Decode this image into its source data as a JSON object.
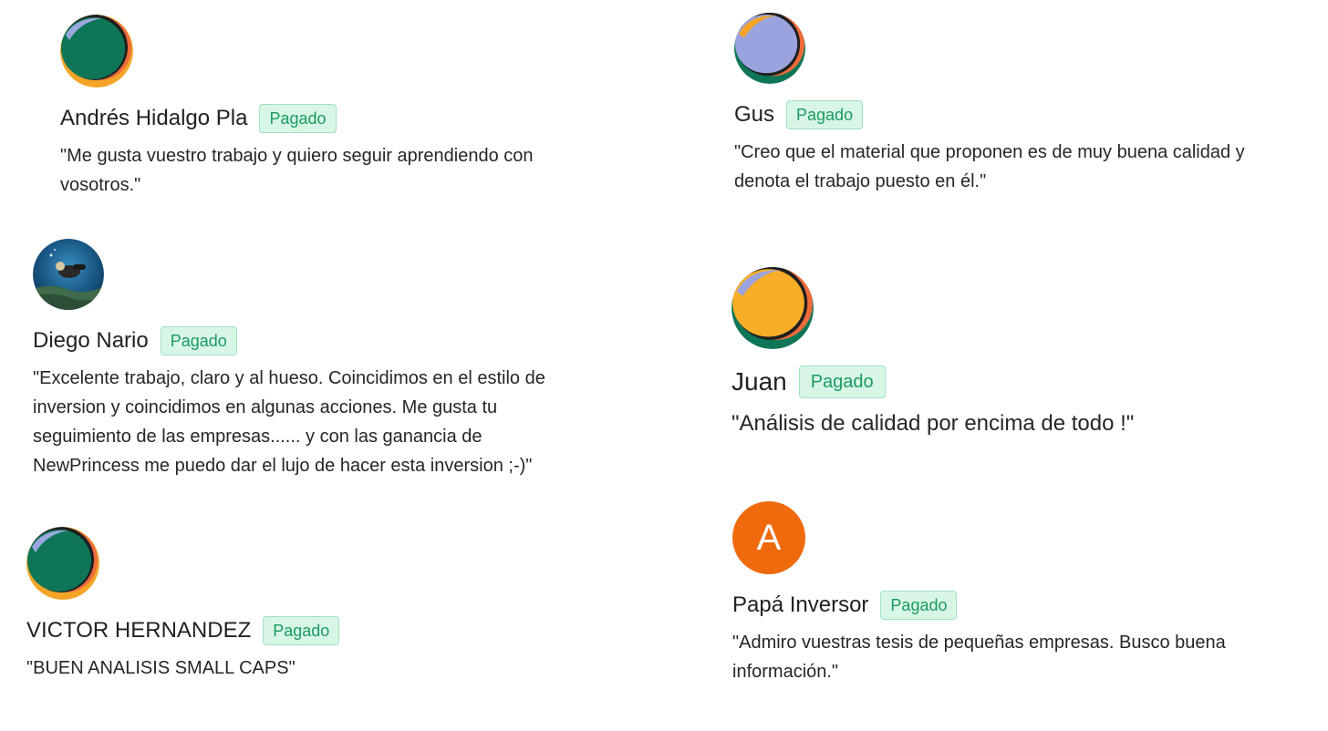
{
  "testimonials": [
    {
      "id": "andres",
      "name": "Andrés Hidalgo Pla",
      "badge": "Pagado",
      "quote": "\"Me gusta vuestro trabajo y quiero seguir aprendiendo con vosotros.\"",
      "avatar": "abstract-green-avatar"
    },
    {
      "id": "diego",
      "name": "Diego Nario",
      "badge": "Pagado",
      "quote": "\"Excelente trabajo, claro y al hueso. Coincidimos en el estilo de inversion y coincidimos en algunas acciones. Me gusta tu seguimiento de las empresas...... y con las ganancia de NewPrincess me puedo dar el lujo de hacer esta inversion ;-)\"",
      "avatar": "diver-photo-avatar"
    },
    {
      "id": "victor",
      "name": "VICTOR HERNANDEZ",
      "badge": "Pagado",
      "quote": "\"BUEN ANALISIS SMALL CAPS\"",
      "avatar": "abstract-green-avatar"
    },
    {
      "id": "gus",
      "name": "Gus",
      "badge": "Pagado",
      "quote": "\"Creo que el material que proponen es de muy buena calidad y denota el trabajo puesto en él.\"",
      "avatar": "abstract-lavender-avatar"
    },
    {
      "id": "juan",
      "name": "Juan",
      "badge": "Pagado",
      "quote": "\"Análisis de calidad por encima de todo !\"",
      "avatar": "abstract-yellow-avatar"
    },
    {
      "id": "papa",
      "name": "Papá Inversor",
      "badge": "Pagado",
      "quote": "\"Admiro vuestras tesis de pequeñas empresas. Busco buena información.\"",
      "avatar": "letter-avatar",
      "avatar_letter": "A"
    }
  ],
  "colors": {
    "badge_text": "#1a9b62",
    "badge_bg": "#d8f6e6",
    "letter_avatar_bg": "#ef6a0d"
  }
}
